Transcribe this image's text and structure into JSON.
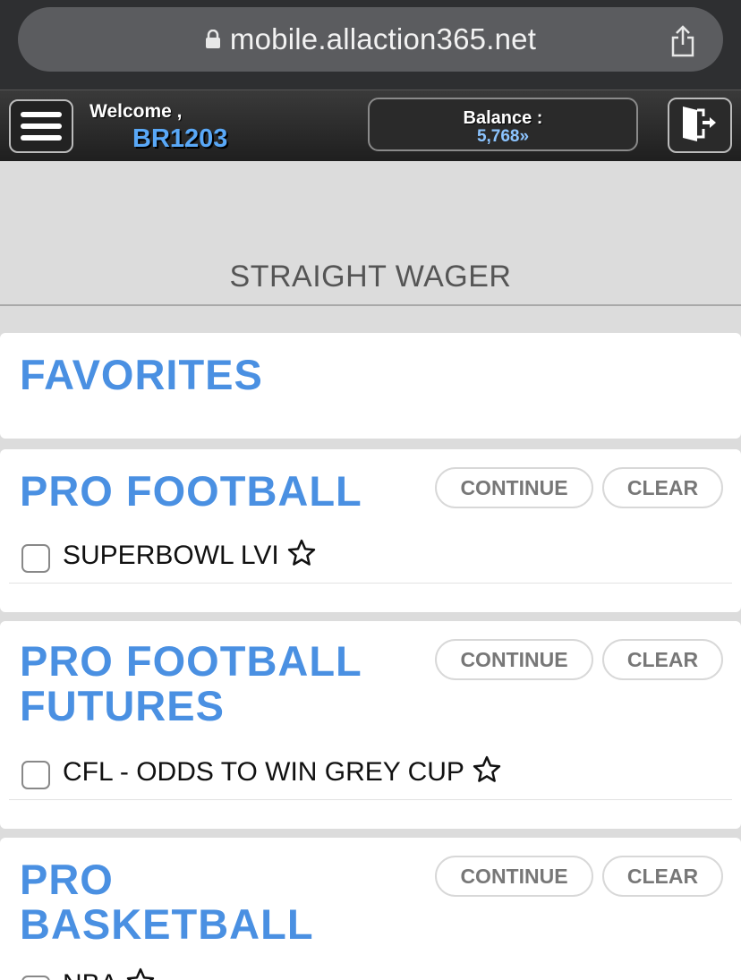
{
  "browser": {
    "url": "mobile.allaction365.net"
  },
  "header": {
    "welcome_label": "Welcome ,",
    "username": "BR1203",
    "balance_label": "Balance :",
    "balance_value": "5,768»"
  },
  "page": {
    "title": "STRAIGHT WAGER"
  },
  "sections": {
    "favorites": {
      "title": "FAVORITES"
    },
    "pro_football": {
      "title": "PRO FOOTBALL",
      "continue_label": "CONTINUE",
      "clear_label": "CLEAR",
      "items": [
        {
          "label": "SUPERBOWL LVI",
          "checked": false
        }
      ]
    },
    "pro_football_futures": {
      "title_line1": "PRO FOOTBALL",
      "title_line2": "FUTURES",
      "continue_label": "CONTINUE",
      "clear_label": "CLEAR",
      "items": [
        {
          "label": "CFL - ODDS TO WIN GREY CUP",
          "checked": false
        }
      ]
    },
    "pro_basketball": {
      "title_line1": "PRO",
      "title_line2": "BASKETBALL",
      "continue_label": "CONTINUE",
      "clear_label": "CLEAR",
      "items": [
        {
          "label": "NBA",
          "checked": false
        }
      ]
    }
  },
  "icons": {
    "lock": "lock-icon",
    "share": "share-icon",
    "menu": "hamburger-menu-icon",
    "logout": "logout-door-icon",
    "favorite": "star-outline-icon"
  },
  "colors": {
    "accent_blue": "#4a90e2",
    "username_blue": "#59a8f7",
    "header_dark": "#2a2a2a",
    "page_bg": "#dcdcdc"
  }
}
